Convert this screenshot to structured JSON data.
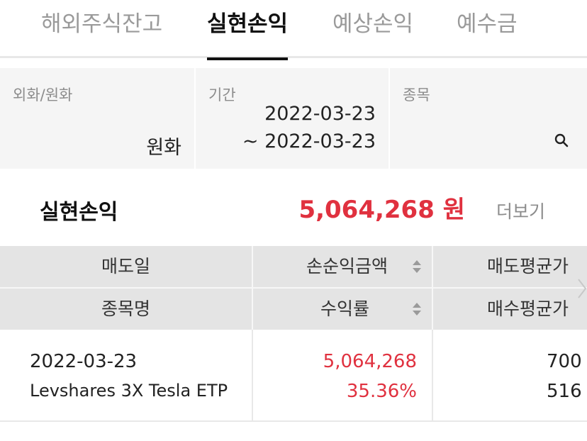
{
  "tabs": [
    {
      "label": "해외주식잔고",
      "active": false
    },
    {
      "label": "실현손익",
      "active": true
    },
    {
      "label": "예상손익",
      "active": false
    },
    {
      "label": "예수금",
      "active": false
    }
  ],
  "filters": {
    "currency": {
      "label": "외화/원화",
      "value": "원화"
    },
    "period": {
      "label": "기간",
      "from": "2022-03-23",
      "to": "~ 2022-03-23"
    },
    "stock": {
      "label": "종목",
      "value": ""
    }
  },
  "summary": {
    "title": "실현손익",
    "amount": "5,064,268 원",
    "more_label": "더보기"
  },
  "table": {
    "header_row1": [
      "매도일",
      "손순익금액",
      "매도평균가"
    ],
    "header_row2": [
      "종목명",
      "수익률",
      "매수평균가"
    ],
    "rows": [
      {
        "sell_date": "2022-03-23",
        "name": "Levshares 3X Tesla ETP",
        "net_profit": "5,064,268",
        "return_rate": "35.36%",
        "sell_avg": "700",
        "buy_avg": "516"
      }
    ]
  },
  "colors": {
    "profit": "#e0313f",
    "header_bg": "#e4e4e4",
    "filter_bg": "#f5f5f5"
  },
  "icons": [
    "search-icon",
    "sort-icon",
    "chevron-right-icon"
  ]
}
